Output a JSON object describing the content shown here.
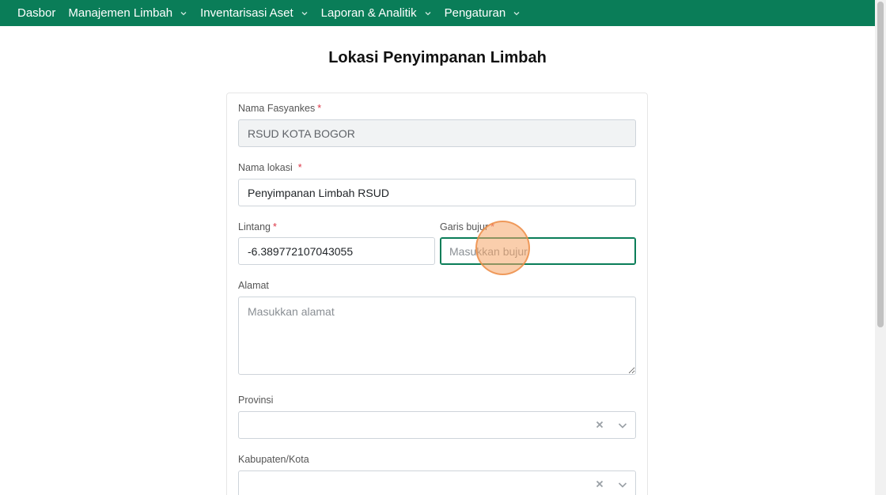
{
  "nav": {
    "items": [
      {
        "label": "Dasbor",
        "has_dropdown": false
      },
      {
        "label": "Manajemen Limbah",
        "has_dropdown": true
      },
      {
        "label": "Inventarisasi Aset",
        "has_dropdown": true
      },
      {
        "label": "Laporan & Analitik",
        "has_dropdown": true
      },
      {
        "label": "Pengaturan",
        "has_dropdown": true
      }
    ],
    "bg_color": "#0a7d58"
  },
  "page": {
    "title": "Lokasi Penyimpanan Limbah"
  },
  "form": {
    "facility": {
      "label": "Nama Fasyankes",
      "required_mark": "*",
      "value": "RSUD KOTA BOGOR"
    },
    "location_name": {
      "label": "Nama lokasi",
      "required_mark": "*",
      "value": "Penyimpanan Limbah RSUD"
    },
    "latitude": {
      "label": "Lintang",
      "required_mark": "*",
      "value": "-6.389772107043055"
    },
    "longitude": {
      "label": "Garis bujur",
      "required_mark": "*",
      "value": "",
      "placeholder": "Masukkan bujur"
    },
    "address": {
      "label": "Alamat",
      "value": "",
      "placeholder": "Masukkan alamat"
    },
    "province": {
      "label": "Provinsi",
      "selected": ""
    },
    "regency": {
      "label": "Kabupaten/Kota",
      "selected": ""
    }
  }
}
